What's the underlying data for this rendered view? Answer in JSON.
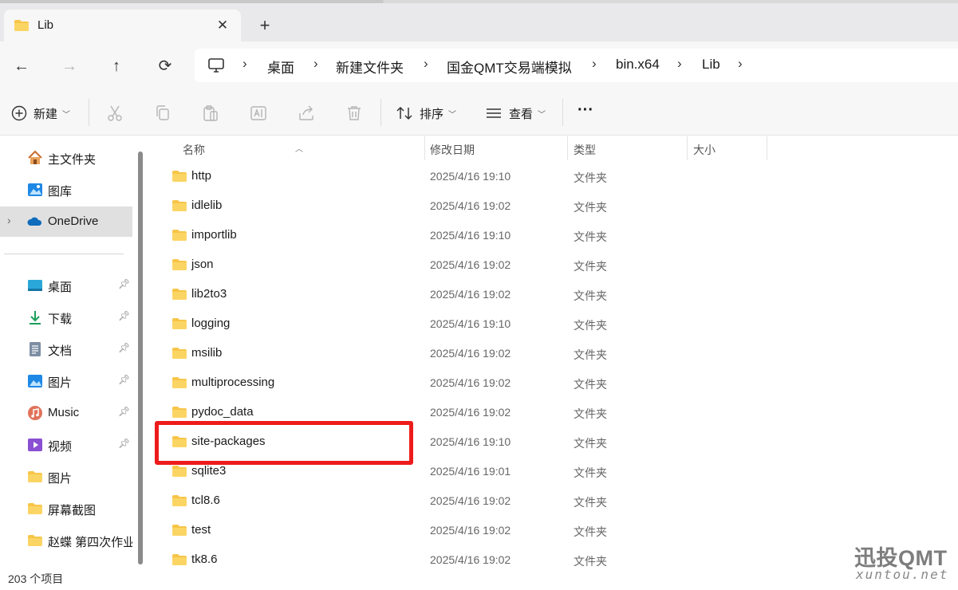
{
  "tab": {
    "title": "Lib",
    "close_glyph": "✕",
    "new_glyph": "+"
  },
  "nav": {
    "back": "←",
    "forward": "→",
    "up": "↑",
    "refresh": "⟳"
  },
  "breadcrumb": [
    "桌面",
    "新建文件夹",
    "国金QMT交易端模拟",
    "bin.x64",
    "Lib"
  ],
  "toolbar": {
    "new_label": "新建",
    "sort_label": "排序",
    "view_label": "查看",
    "more_label": "···"
  },
  "sidebar": {
    "top_items": [
      {
        "label": "主文件夹",
        "icon": "home-icon"
      },
      {
        "label": "图库",
        "icon": "gallery-icon"
      },
      {
        "label": "OneDrive",
        "icon": "onedrive-icon"
      }
    ],
    "quick_items": [
      {
        "label": "桌面",
        "icon": "desktop-icon",
        "pinned": true
      },
      {
        "label": "下载",
        "icon": "download-icon",
        "pinned": true
      },
      {
        "label": "文档",
        "icon": "document-icon",
        "pinned": true
      },
      {
        "label": "图片",
        "icon": "pictures-icon",
        "pinned": true
      },
      {
        "label": "Music",
        "icon": "music-icon",
        "pinned": true
      },
      {
        "label": "视频",
        "icon": "video-icon",
        "pinned": true
      },
      {
        "label": "图片",
        "icon": "folder-icon",
        "pinned": false
      },
      {
        "label": "屏幕截图",
        "icon": "folder-icon",
        "pinned": false
      },
      {
        "label": "赵蝶 第四次作业",
        "icon": "folder-icon",
        "pinned": false
      }
    ]
  },
  "columns": {
    "name": "名称",
    "modified": "修改日期",
    "type": "类型",
    "size": "大小"
  },
  "files": [
    {
      "name": "http",
      "modified": "2025/4/16 19:10",
      "type": "文件夹"
    },
    {
      "name": "idlelib",
      "modified": "2025/4/16 19:02",
      "type": "文件夹"
    },
    {
      "name": "importlib",
      "modified": "2025/4/16 19:10",
      "type": "文件夹"
    },
    {
      "name": "json",
      "modified": "2025/4/16 19:02",
      "type": "文件夹"
    },
    {
      "name": "lib2to3",
      "modified": "2025/4/16 19:02",
      "type": "文件夹"
    },
    {
      "name": "logging",
      "modified": "2025/4/16 19:10",
      "type": "文件夹"
    },
    {
      "name": "msilib",
      "modified": "2025/4/16 19:02",
      "type": "文件夹"
    },
    {
      "name": "multiprocessing",
      "modified": "2025/4/16 19:02",
      "type": "文件夹"
    },
    {
      "name": "pydoc_data",
      "modified": "2025/4/16 19:02",
      "type": "文件夹"
    },
    {
      "name": "site-packages",
      "modified": "2025/4/16 19:10",
      "type": "文件夹"
    },
    {
      "name": "sqlite3",
      "modified": "2025/4/16 19:01",
      "type": "文件夹"
    },
    {
      "name": "tcl8.6",
      "modified": "2025/4/16 19:02",
      "type": "文件夹"
    },
    {
      "name": "test",
      "modified": "2025/4/16 19:02",
      "type": "文件夹"
    },
    {
      "name": "tk8.6",
      "modified": "2025/4/16 19:02",
      "type": "文件夹"
    }
  ],
  "highlighted_file": "site-packages",
  "status": {
    "item_count": "203 个项目"
  },
  "watermark": {
    "brand": "迅投QMT",
    "domain": "xuntou.net"
  },
  "colors": {
    "folder": "#f7c548",
    "highlight": "#ee1b1b",
    "onedrive": "#0f6cbd"
  }
}
